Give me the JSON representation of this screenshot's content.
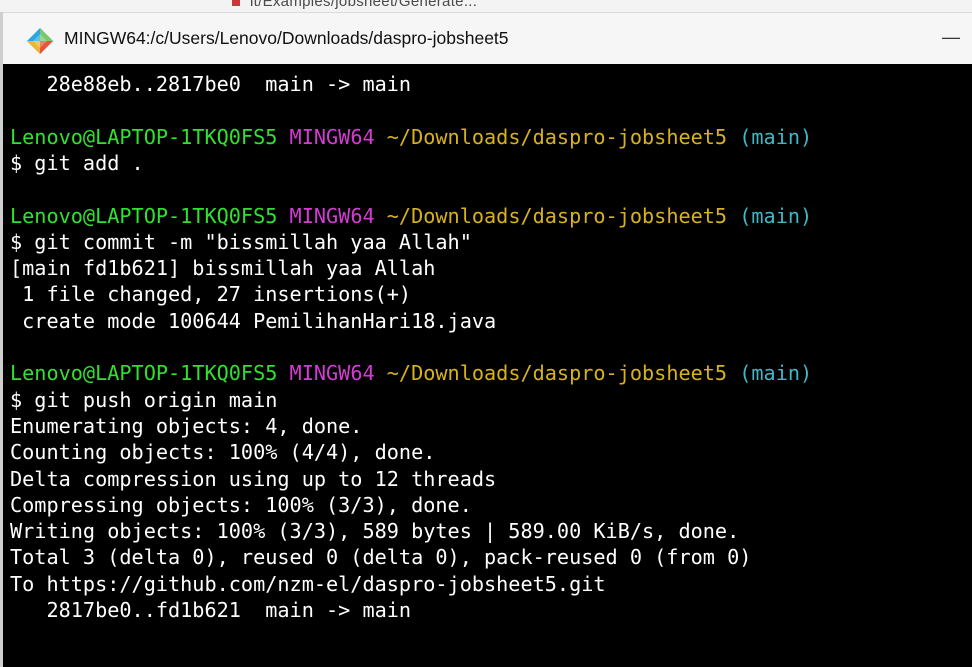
{
  "background_window": {
    "partial_title": "lt/Examples/jobsheet/Generate..."
  },
  "window": {
    "title": "MINGW64:/c/Users/Lenovo/Downloads/daspro-jobsheet5",
    "icon": "git-bash-icon",
    "minimize_label": "—"
  },
  "colors": {
    "user": "#2ee22e",
    "host": "#d43bd4",
    "path": "#d8b21e",
    "branch": "#3fb7c4",
    "output": "#ffffff",
    "background": "#000000"
  },
  "terminal": {
    "lines": [
      {
        "text": "   28e88eb..2817be0  main -> main"
      },
      {
        "text": ""
      },
      {
        "prompt": {
          "user": "Lenovo@LAPTOP-1TKQ0FS5",
          "host": "MINGW64",
          "path": "~/Downloads/daspro-jobsheet5",
          "branch": "(main)"
        }
      },
      {
        "text": "$ git add ."
      },
      {
        "text": ""
      },
      {
        "prompt": {
          "user": "Lenovo@LAPTOP-1TKQ0FS5",
          "host": "MINGW64",
          "path": "~/Downloads/daspro-jobsheet5",
          "branch": "(main)"
        }
      },
      {
        "text": "$ git commit -m \"bissmillah yaa Allah\""
      },
      {
        "text": "[main fd1b621] bissmillah yaa Allah"
      },
      {
        "text": " 1 file changed, 27 insertions(+)"
      },
      {
        "text": " create mode 100644 PemilihanHari18.java"
      },
      {
        "text": ""
      },
      {
        "prompt": {
          "user": "Lenovo@LAPTOP-1TKQ0FS5",
          "host": "MINGW64",
          "path": "~/Downloads/daspro-jobsheet5",
          "branch": "(main)"
        }
      },
      {
        "text": "$ git push origin main"
      },
      {
        "text": "Enumerating objects: 4, done."
      },
      {
        "text": "Counting objects: 100% (4/4), done."
      },
      {
        "text": "Delta compression using up to 12 threads"
      },
      {
        "text": "Compressing objects: 100% (3/3), done."
      },
      {
        "text": "Writing objects: 100% (3/3), 589 bytes | 589.00 KiB/s, done."
      },
      {
        "text": "Total 3 (delta 0), reused 0 (delta 0), pack-reused 0 (from 0)"
      },
      {
        "text": "To https://github.com/nzm-el/daspro-jobsheet5.git"
      },
      {
        "text": "   2817be0..fd1b621  main -> main"
      }
    ]
  }
}
